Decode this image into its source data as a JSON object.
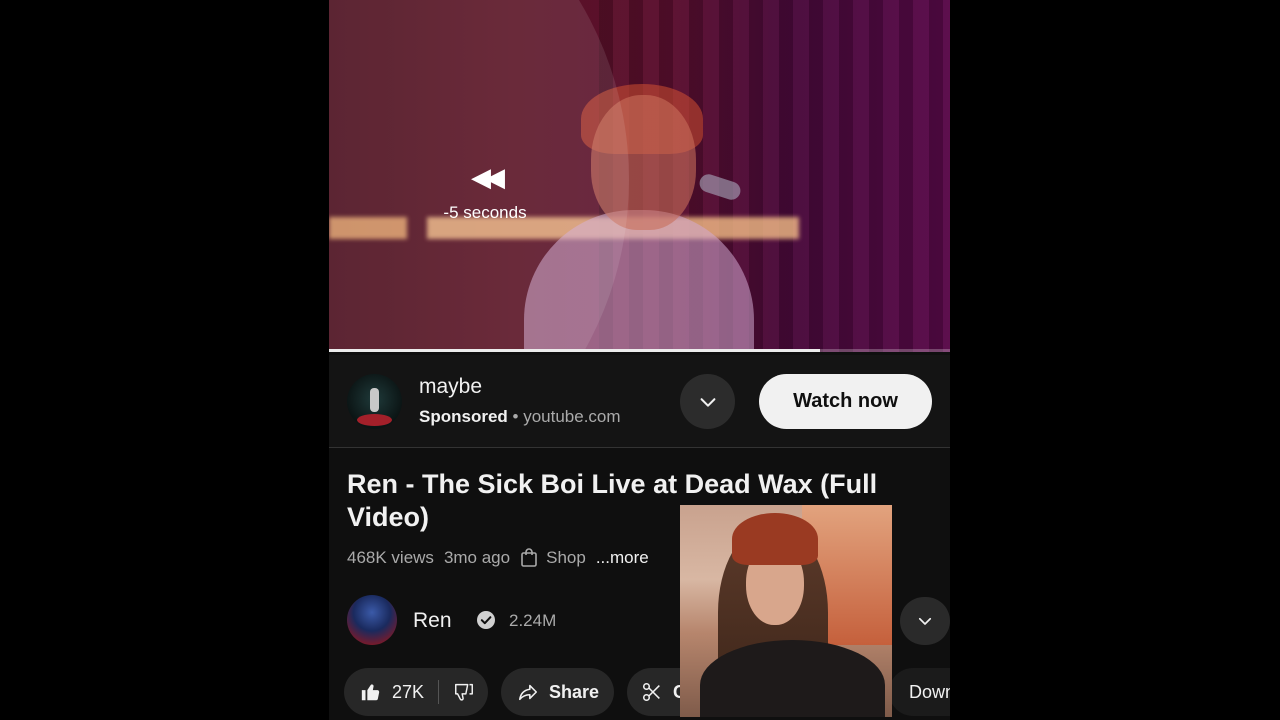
{
  "player": {
    "seek_text": "-5 seconds",
    "seek_glyph": "◀◀",
    "progress_fraction": 0.79
  },
  "ad": {
    "title": "maybe",
    "sponsored_label": "Sponsored",
    "separator": " • ",
    "domain": "youtube.com",
    "cta_label": "Watch now"
  },
  "video": {
    "title": "Ren - The Sick Boi Live at Dead Wax (Full Video)",
    "views": "468K views",
    "age": "3mo ago",
    "shop_label": "Shop",
    "more_label": "...more"
  },
  "channel": {
    "name": "Ren",
    "subscribers": "2.24M"
  },
  "actions": {
    "like_count": "27K",
    "share_label": "Share",
    "clip_label": "Cl",
    "download_label": "Down"
  },
  "colors": {
    "background": "#0f0f0f",
    "pill": "#272727",
    "cta_bg": "#f1f1f1",
    "secondary_text": "#aaaaaa"
  },
  "icons": [
    "rewind-icon",
    "chevron-down-icon",
    "shop-bag-icon",
    "verified-icon",
    "like-icon",
    "dislike-icon",
    "share-icon",
    "clip-scissors-icon",
    "download-icon"
  ]
}
